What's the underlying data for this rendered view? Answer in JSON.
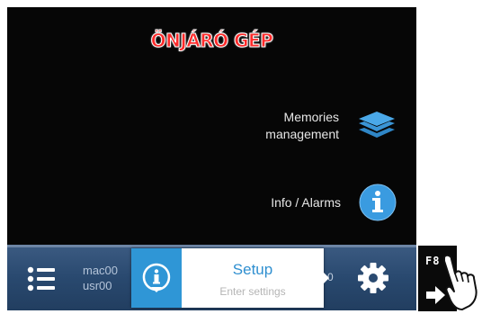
{
  "screen": {
    "title": "ÖNJÁRÓ GÉP"
  },
  "menu": {
    "memories": {
      "label_line1": "Memories",
      "label_line2": "management",
      "icon": "layers-icon"
    },
    "info": {
      "label": "Info / Alarms",
      "icon": "info-icon"
    }
  },
  "bottom_bar": {
    "machine": "mac00",
    "user": "usr00",
    "setup_title": "Setup",
    "setup_subtitle": "Enter settings",
    "hidden_text": "0",
    "list_icon": "list-icon",
    "settings_icon": "gear-icon"
  },
  "key": {
    "label": "F8",
    "arrow_icon": "right-arrow-icon",
    "hand_icon": "pointing-hand-icon"
  },
  "colors": {
    "title": "#ff2a2a",
    "accent_blue": "#2f96d6",
    "bar": "#29496f"
  }
}
